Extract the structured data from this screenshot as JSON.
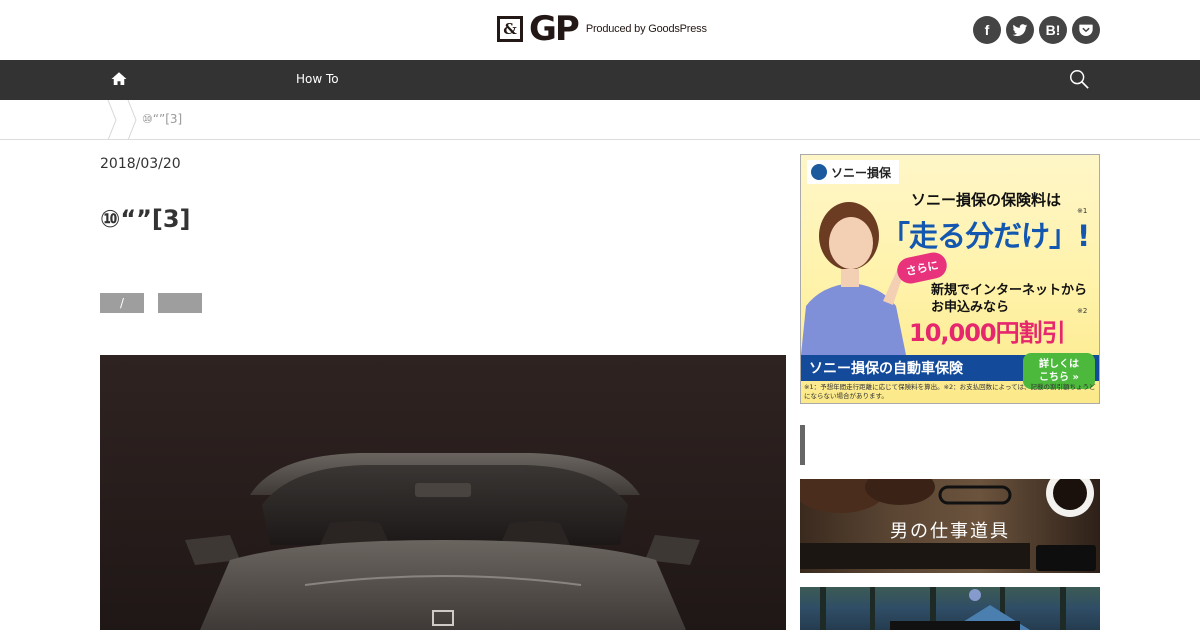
{
  "header": {
    "logo_amp": "&",
    "logo_gp": "GP",
    "logo_sub": "Produced by GoodsPress",
    "social": [
      {
        "icon": "facebook-icon",
        "label": "f"
      },
      {
        "icon": "twitter-icon",
        "label": ""
      },
      {
        "icon": "hatena-bookmark-icon",
        "label": "B!"
      },
      {
        "icon": "pocket-icon",
        "label": ""
      }
    ]
  },
  "nav": {
    "home_icon": "home-icon",
    "howto_label": "How To",
    "search_icon": "search-icon"
  },
  "breadcrumb": {
    "current": "⑩“”[3]"
  },
  "article": {
    "date": "2018/03/20",
    "title": "⑩“”[3]",
    "tags": [
      "/",
      ""
    ]
  },
  "sidebar": {
    "ad": {
      "brand": "ソニー損保",
      "headline": "ソニー損保の保険料は",
      "main": "「走る分だけ」!",
      "note1": "※1",
      "badge": "さらに",
      "line1": "新規でインターネットから",
      "line2": "お申込みなら",
      "price": "10,000円割引",
      "note2": "※2",
      "band": "ソニー損保の自動車保険",
      "cta_line1": "詳しくは",
      "cta_line2": "こちら »",
      "fine": "※1：予想年間走行距離に応じて保険料を算出。※2：お支払回数によっては、記載の割引額ちょうどにならない場合があります。"
    },
    "banner1_title": "男の仕事道具"
  },
  "colors": {
    "navbar": "#333333",
    "tag": "#9e9e9e",
    "ad_blue": "#134a9a",
    "ad_pink": "#e6266d",
    "ad_green": "#4cb83c"
  }
}
